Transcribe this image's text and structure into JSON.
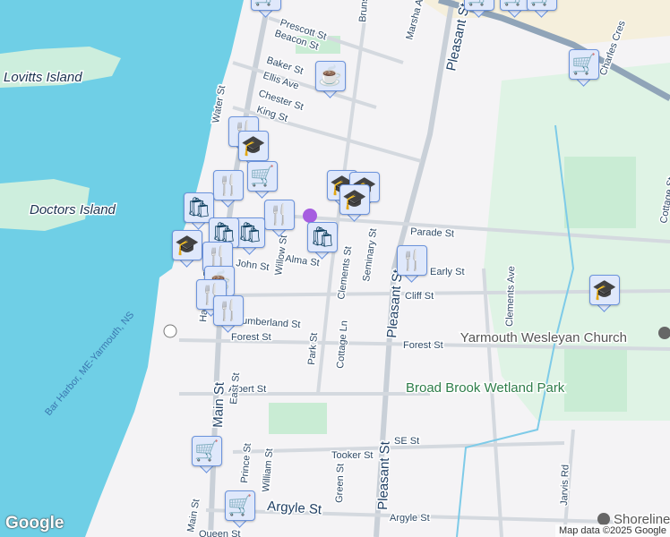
{
  "streets": [
    "Prescott St",
    "Beacon St",
    "Baker St",
    "Ellis Ave",
    "Chester St",
    "King St",
    "Water St",
    "Brunswick St",
    "Marsha Ave",
    "Pleasant St",
    "Charles Cres",
    "Parade St",
    "Alma St",
    "John St",
    "Willow St",
    "Clements St",
    "Seminary St",
    "Cliff St",
    "Cumberland St",
    "Forest St",
    "Park St",
    "Cottage Ln",
    "Albert St",
    "Main St",
    "East St",
    "Prince St",
    "William St",
    "Green St",
    "Tooker St",
    "SE St",
    "Argyle St",
    "Jarvis Rd",
    "Clements Ave",
    "Cottage St",
    "Queen St",
    "Hawthorn St",
    "Forest St",
    "Argyle St",
    "Early St",
    "Main St",
    "Pleasant St",
    "Pleasant St"
  ],
  "places": {
    "lovitts": "Lovitts Island",
    "doctors": "Doctors Island",
    "wetland": "Broad Brook Wetland Park",
    "church": "Yarmouth Wesleyan Church",
    "shoreline": "Shoreline",
    "ferry": "Bar Harbor, ME-Yarmouth, NS"
  },
  "markers": [
    {
      "type": "grocery",
      "icon": "🛒"
    },
    {
      "type": "grocery",
      "icon": "🛒"
    },
    {
      "type": "grocery",
      "icon": "🛒"
    },
    {
      "type": "grocery",
      "icon": "🛒"
    },
    {
      "type": "cafe",
      "icon": "☕"
    },
    {
      "type": "grocery",
      "icon": "🛒"
    },
    {
      "type": "restaurant",
      "icon": "🍴"
    },
    {
      "type": "school",
      "icon": "🎓"
    },
    {
      "type": "grocery",
      "icon": "🛒"
    },
    {
      "type": "restaurant",
      "icon": "🍴"
    },
    {
      "type": "school",
      "icon": "🎓"
    },
    {
      "type": "school",
      "icon": "🎓"
    },
    {
      "type": "school",
      "icon": "🎓"
    },
    {
      "type": "shopping",
      "icon": "🛍"
    },
    {
      "type": "restaurant",
      "icon": "🍴"
    },
    {
      "type": "shopping",
      "icon": "🛍"
    },
    {
      "type": "shopping",
      "icon": "🛍"
    },
    {
      "type": "shopping",
      "icon": "🛍"
    },
    {
      "type": "school",
      "icon": "🎓"
    },
    {
      "type": "restaurant",
      "icon": "🍴"
    },
    {
      "type": "cafe",
      "icon": "☕"
    },
    {
      "type": "restaurant",
      "icon": "🍴"
    },
    {
      "type": "restaurant",
      "icon": "🍴"
    },
    {
      "type": "restaurant",
      "icon": "🍴"
    },
    {
      "type": "school",
      "icon": "🎓"
    },
    {
      "type": "grocery",
      "icon": "🛒"
    },
    {
      "type": "grocery",
      "icon": "🛒"
    }
  ],
  "logo": "Google",
  "attribution": "Map data ©2025 Google",
  "colors": {
    "water": "#6fcfe6",
    "park": "#d4f0dd",
    "land": "#f4f3f5",
    "pin": "#dfe8fb"
  }
}
